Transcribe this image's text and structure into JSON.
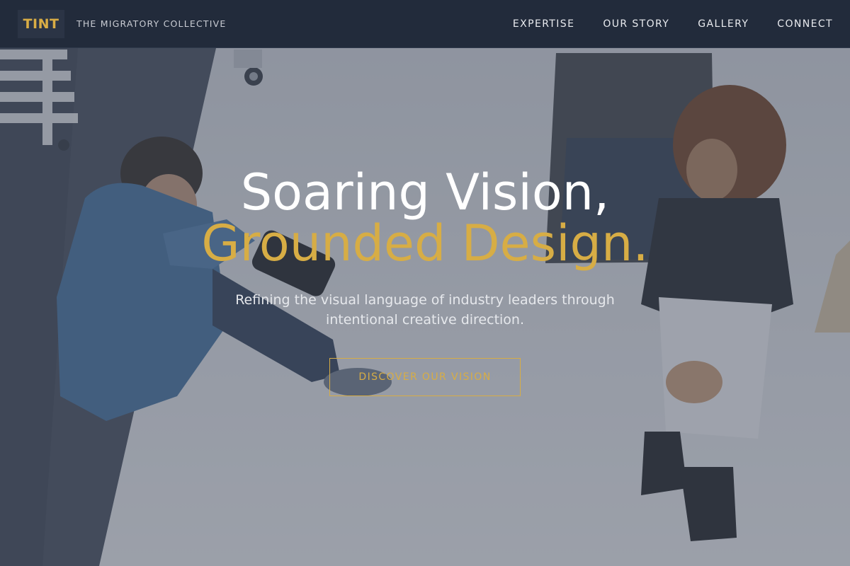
{
  "brand": {
    "logo": "TINT",
    "tagline": "THE MIGRATORY COLLECTIVE"
  },
  "nav": {
    "items": [
      "EXPERTISE",
      "OUR STORY",
      "GALLERY",
      "CONNECT"
    ]
  },
  "hero": {
    "headline_line1": "Soaring Vision,",
    "headline_line2": "Grounded Design.",
    "subtext": "Refining the visual language of industry leaders through intentional creative direction.",
    "cta_label": "DISCOVER OUR VISION",
    "image_semantic": "photographer-and-model-photo"
  },
  "colors": {
    "nav_bg": "#222b3b",
    "accent_gold": "#d7ad45",
    "headline_white": "#ffffff",
    "overlay": "#485062"
  }
}
